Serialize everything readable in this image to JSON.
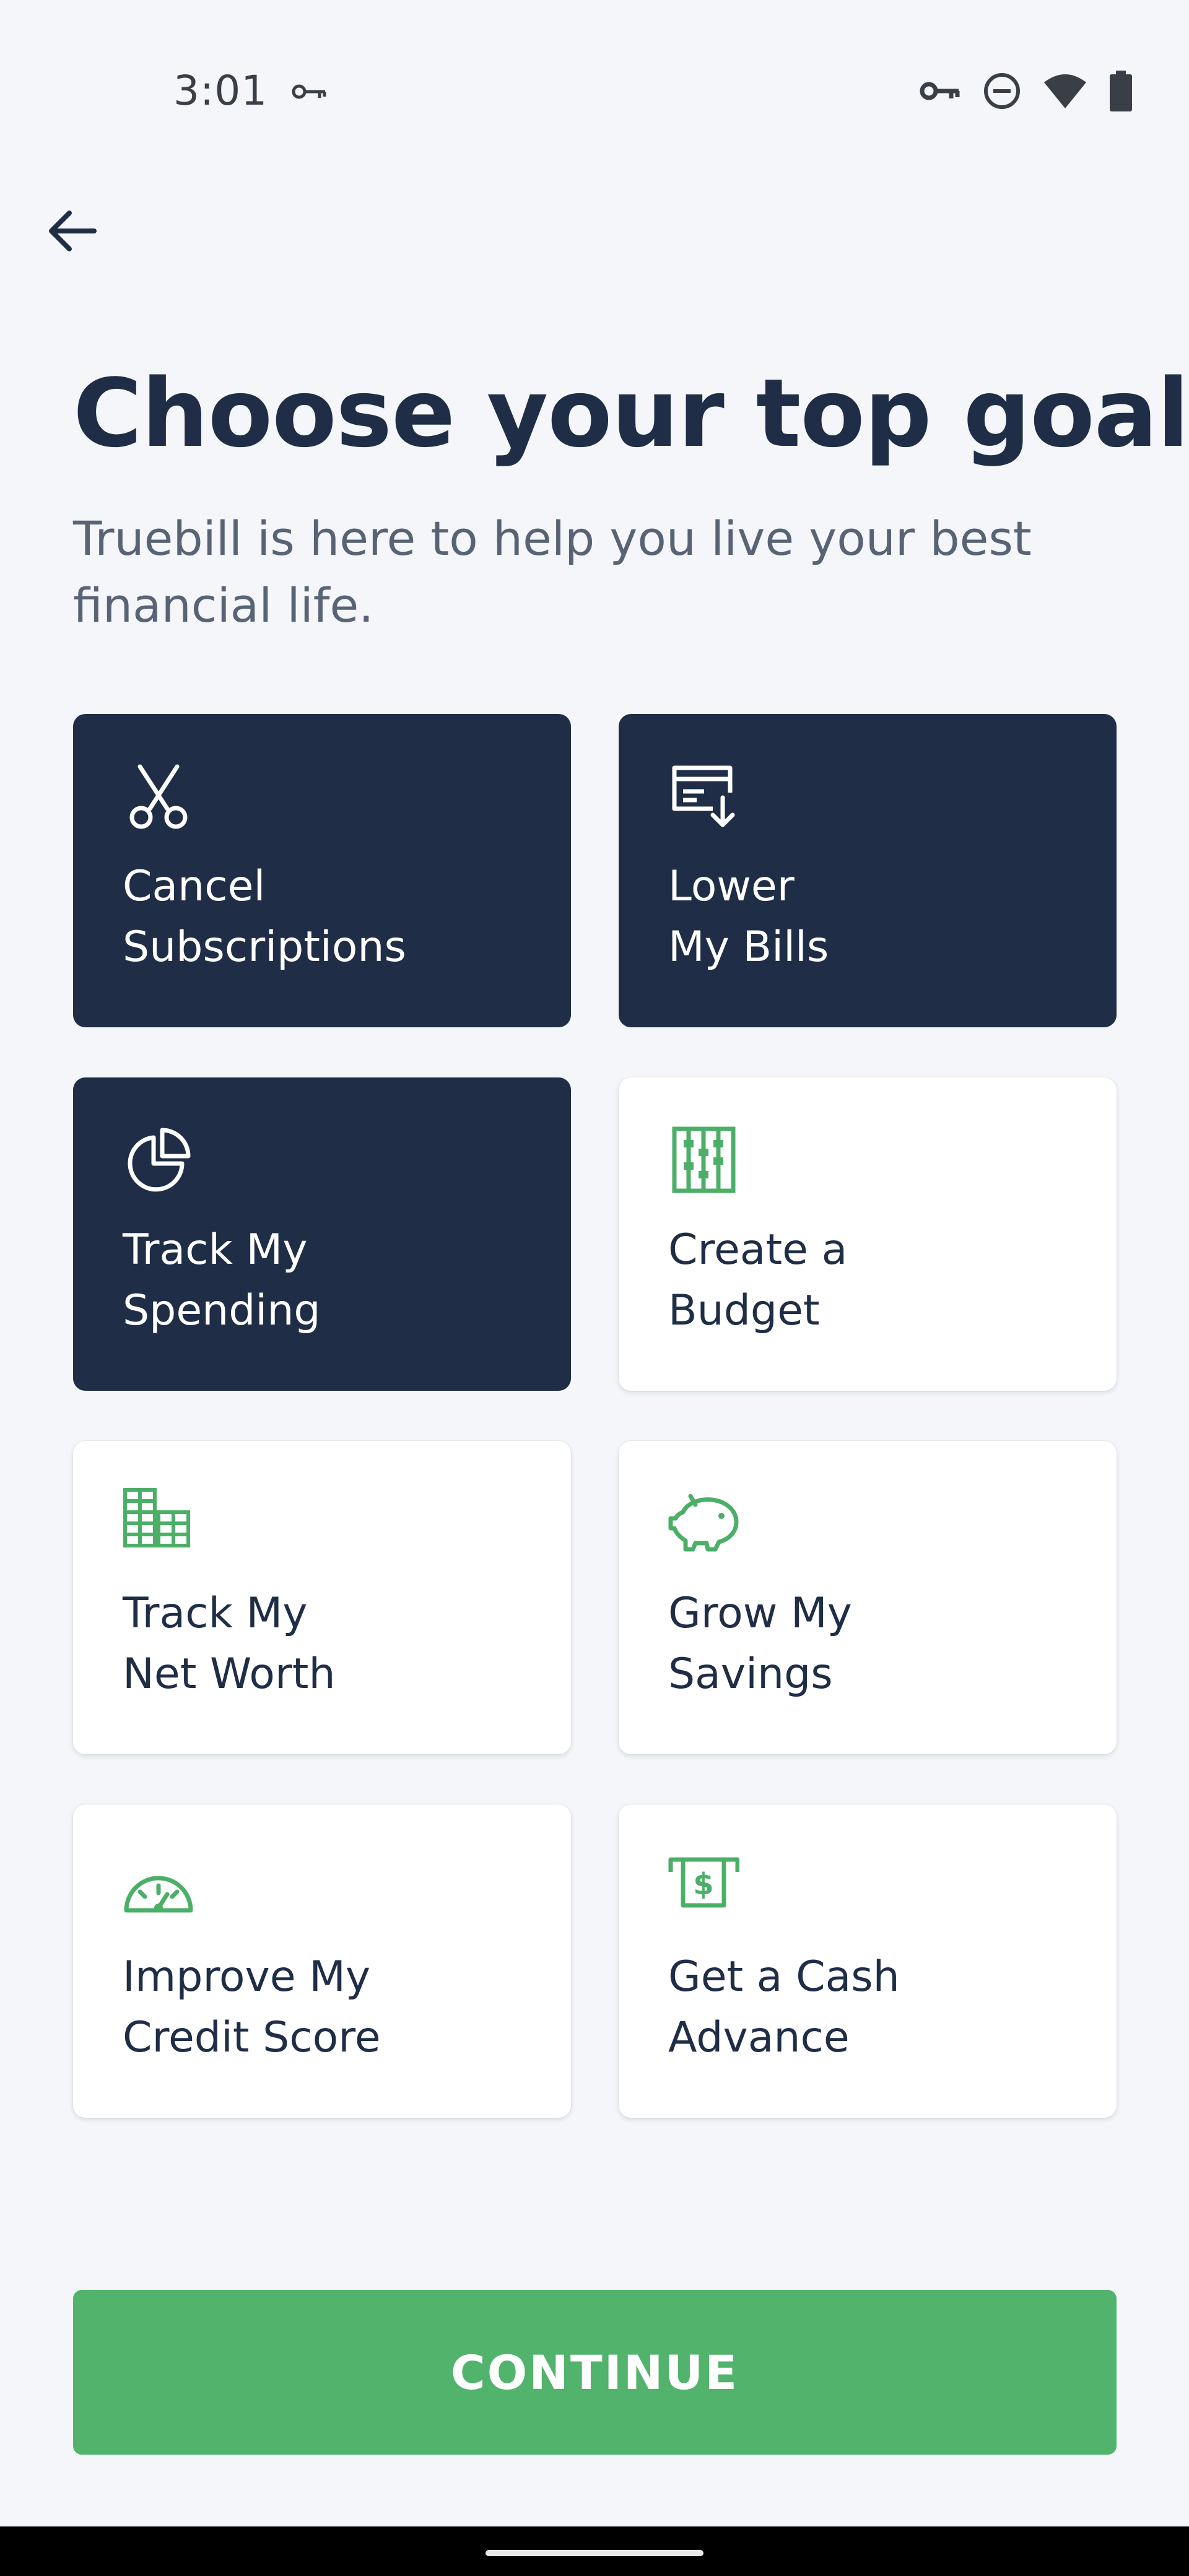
{
  "status_bar": {
    "time": "3:01",
    "left_icons": [
      "vpn-key-icon"
    ],
    "right_icons": [
      "vpn-key-icon",
      "do-not-disturb-icon",
      "wifi-icon",
      "battery-icon"
    ]
  },
  "header": {
    "back_icon": "arrow-left-icon",
    "title": "Choose your top goals",
    "subtitle": "Truebill is here to help you live your best financial life."
  },
  "goals": [
    {
      "label": "Cancel\nSubscriptions",
      "icon": "scissors-icon",
      "selected": true
    },
    {
      "label": "Lower\nMy Bills",
      "icon": "bill-download-icon",
      "selected": true
    },
    {
      "label": "Track My\nSpending",
      "icon": "pie-chart-icon",
      "selected": true
    },
    {
      "label": "Create a\nBudget",
      "icon": "abacus-icon",
      "selected": false
    },
    {
      "label": "Track My\nNet Worth",
      "icon": "bricks-icon",
      "selected": false
    },
    {
      "label": "Grow My\nSavings",
      "icon": "piggy-bank-icon",
      "selected": false
    },
    {
      "label": "Improve My\nCredit Score",
      "icon": "gauge-icon",
      "selected": false
    },
    {
      "label": "Get a Cash\nAdvance",
      "icon": "cash-atm-icon",
      "selected": false
    }
  ],
  "continue_label": "CONTINUE",
  "colors": {
    "navy": "#1f2e46",
    "green": "#52b36c",
    "background": "#f4f6f9",
    "icon_green": "#4caf68"
  }
}
